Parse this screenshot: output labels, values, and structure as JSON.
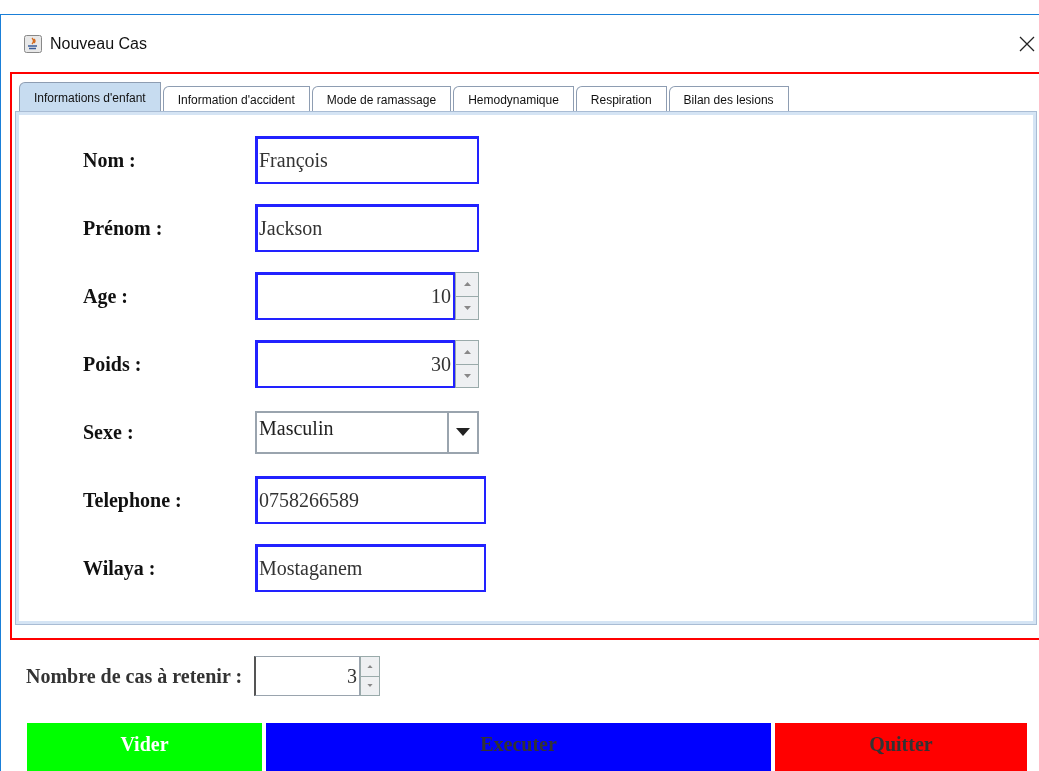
{
  "window": {
    "title": "Nouveau Cas"
  },
  "tabs": [
    {
      "label": "Informations d'enfant",
      "selected": true
    },
    {
      "label": "Information d'accident",
      "selected": false
    },
    {
      "label": "Mode de ramassage",
      "selected": false
    },
    {
      "label": "Hemodynamique",
      "selected": false
    },
    {
      "label": "Respiration",
      "selected": false
    },
    {
      "label": "Bilan des lesions",
      "selected": false
    }
  ],
  "fields": [
    {
      "label": "Nom :",
      "kind": "text",
      "value": "François"
    },
    {
      "label": "Prénom :",
      "kind": "text",
      "value": "Jackson"
    },
    {
      "label": "Age :",
      "kind": "spinner",
      "value": "10"
    },
    {
      "label": "Poids :",
      "kind": "spinner",
      "value": "30"
    },
    {
      "label": "Sexe :",
      "kind": "combo",
      "value": "Masculin"
    },
    {
      "label": "Telephone :",
      "kind": "text",
      "value": "0758266589"
    },
    {
      "label": "Wilaya :",
      "kind": "text",
      "value": "Mostaganem"
    }
  ],
  "retain": {
    "label": "Nombre de cas à retenir :",
    "value": "3"
  },
  "buttons": [
    {
      "label": "Vider",
      "color": "#00ff00",
      "disabled": false
    },
    {
      "label": "Executer",
      "color": "#0000ff",
      "disabled": true
    },
    {
      "label": "Quitter",
      "color": "#ff0000",
      "disabled": true
    }
  ]
}
